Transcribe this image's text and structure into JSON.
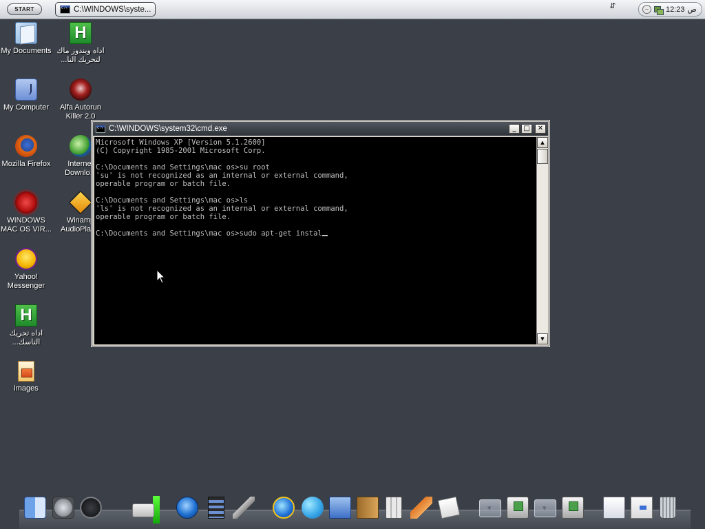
{
  "taskbar": {
    "start_label": "START",
    "tasks": [
      {
        "label": "C:\\WINDOWS\\syste..."
      }
    ],
    "tray": {
      "time": "12:23",
      "ampm": "ص"
    }
  },
  "desktop": {
    "icons": [
      {
        "label": "My Documents"
      },
      {
        "label": "اداه ويندوز ماك لتحريك النا..."
      },
      {
        "label": "My Computer"
      },
      {
        "label": "Alfa Autorun Killer 2.0"
      },
      {
        "label": "Mozilla Firefox"
      },
      {
        "label": "Internet Downlo..."
      },
      {
        "label": "WINDOWS MAC OS VIR..."
      },
      {
        "label": "Winamp AudioPlay..."
      },
      {
        "label": "Yahoo! Messenger"
      },
      {
        "label": "اداه تحريك التاسك..."
      },
      {
        "label": "images"
      }
    ]
  },
  "cmd_window": {
    "title": "C:\\WINDOWS\\system32\\cmd.exe",
    "lines": [
      "Microsoft Windows XP [Version 5.1.2600]",
      "(C) Copyright 1985-2001 Microsoft Corp.",
      "",
      "C:\\Documents and Settings\\mac os>su root",
      "'su' is not recognized as an internal or external command,",
      "operable program or batch file.",
      "",
      "C:\\Documents and Settings\\mac os>ls",
      "'ls' is not recognized as an internal or external command,",
      "operable program or batch file.",
      ""
    ],
    "prompt": "C:\\Documents and Settings\\mac os>",
    "current_input": "sudo apt-get instal"
  },
  "dock": {
    "items": [
      {
        "icon": "finder-icon"
      },
      {
        "icon": "system-preferences-icon"
      },
      {
        "icon": "power-icon"
      },
      {
        "icon": "drive-icon"
      },
      {
        "icon": "media-player-icon"
      },
      {
        "icon": "film-strip-icon"
      },
      {
        "icon": "tools-icon"
      },
      {
        "icon": "internet-explorer-icon"
      },
      {
        "icon": "messenger-icon"
      },
      {
        "icon": "mail-icon"
      },
      {
        "icon": "address-book-icon"
      },
      {
        "icon": "calculator-icon"
      },
      {
        "icon": "applications-icon"
      },
      {
        "icon": "notes-icon"
      },
      {
        "icon": "stack-icon"
      },
      {
        "icon": "package-icon"
      },
      {
        "icon": "stack-icon"
      },
      {
        "icon": "install-icon"
      },
      {
        "icon": "document-icon"
      },
      {
        "icon": "screen-icon"
      },
      {
        "icon": "trash-icon"
      }
    ]
  }
}
